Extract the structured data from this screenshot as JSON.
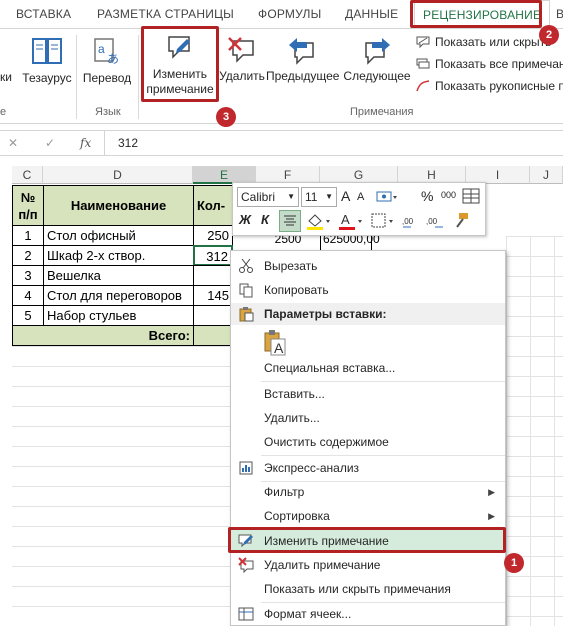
{
  "ribbon_tabs": [
    "ВСТАВКА",
    "РАЗМЕТКА СТРАНИЦЫ",
    "ФОРМУЛЫ",
    "ДАННЫЕ",
    "РЕЦЕНЗИРОВАНИЕ",
    "В"
  ],
  "ribbon": {
    "left_cut_label": "ки",
    "left_cut_group": "е",
    "thesaurus": "Тезаурус",
    "translate": "Перевод",
    "language_group": "Язык",
    "edit_comment_line1": "Изменить",
    "edit_comment_line2": "примечание",
    "delete": "Удалить",
    "previous": "Предыдущее",
    "next": "Следующее",
    "show_hide_comment": "Показать или скрыть",
    "show_all_comments": "Показать все примечан",
    "show_ink": "Показать рукописные п",
    "comments_group": "Примечания"
  },
  "formula_bar": {
    "cancel": "✕",
    "enter": "✓",
    "fx": "fx",
    "value": "312"
  },
  "columns": [
    "C",
    "D",
    "E",
    "F",
    "G",
    "H",
    "I",
    "J"
  ],
  "table": {
    "header_num": "№\nп/п",
    "header_num_l1": "№",
    "header_num_l2": "п/п",
    "header_name": "Наименование",
    "header_qty": "Кол-",
    "rows": [
      {
        "num": "1",
        "name": "Стол офисный",
        "qty": "250",
        "f": "2500",
        "g": "625000,00"
      },
      {
        "num": "2",
        "name": "Шкаф 2-х створ.",
        "qty": "312",
        "f": "",
        "g": ""
      },
      {
        "num": "3",
        "name": "Вешелка",
        "qty": "",
        "f": "",
        "g": ""
      },
      {
        "num": "4",
        "name": "Стол для переговоров",
        "qty": "145",
        "f": "",
        "g": ""
      },
      {
        "num": "5",
        "name": "Набор стульев",
        "qty": "",
        "f": "",
        "g": ""
      }
    ],
    "total_label": "Всего:"
  },
  "mini_toolbar": {
    "font": "Calibri",
    "size": "11",
    "grow": "A",
    "shrink": "A",
    "bold": "Ж",
    "italic": "К",
    "percent": "%",
    "thousands": "000"
  },
  "context_menu": {
    "cut": "Вырезать",
    "copy": "Копировать",
    "paste_options": "Параметры вставки:",
    "paste_special": "Специальная вставка...",
    "insert": "Вставить...",
    "delete": "Удалить...",
    "clear": "Очистить содержимое",
    "quick_analysis": "Экспресс-анализ",
    "filter": "Фильтр",
    "sort": "Сортировка",
    "edit_comment": "Изменить примечание",
    "delete_comment": "Удалить примечание",
    "show_hide_comments": "Показать или скрыть примечания",
    "format_cells": "Формат ячеек..."
  },
  "badges": [
    "1",
    "2",
    "3"
  ],
  "colors": {
    "excel_green": "#217346",
    "callout_red": "#c0282d",
    "table_fill": "#d6e3bc",
    "menu_highlight": "#d5ecdd"
  }
}
